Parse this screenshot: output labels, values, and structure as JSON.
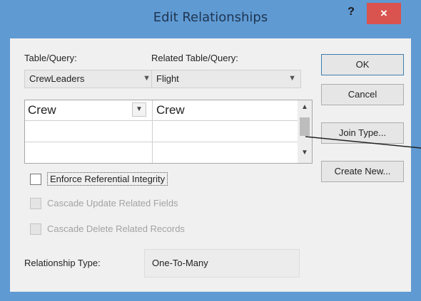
{
  "window": {
    "title": "Edit Relationships",
    "help": "?",
    "close": "×"
  },
  "labels": {
    "table_query": "Table/Query:",
    "related_table_query": "Related Table/Query:"
  },
  "combos": {
    "table_value": "CrewLeaders",
    "related_value": "Flight"
  },
  "grid": {
    "rows": [
      {
        "left": "Crew",
        "right": "Crew"
      }
    ]
  },
  "buttons": {
    "ok": "OK",
    "cancel": "Cancel",
    "join_type": "Join Type...",
    "create_new": "Create New..."
  },
  "checkboxes": {
    "enforce": "Enforce Referential Integrity",
    "cascade_update": "Cascade Update Related Fields",
    "cascade_delete": "Cascade Delete Related Records"
  },
  "relationship": {
    "label": "Relationship Type:",
    "value": "One-To-Many"
  },
  "icons": {
    "dropdown": "chevron-down-icon",
    "scroll_up": "chevron-up-icon",
    "scroll_down": "chevron-down-icon"
  },
  "colors": {
    "frame": "#5f9ad3",
    "close": "#d9534f",
    "client": "#f0f0f0"
  }
}
